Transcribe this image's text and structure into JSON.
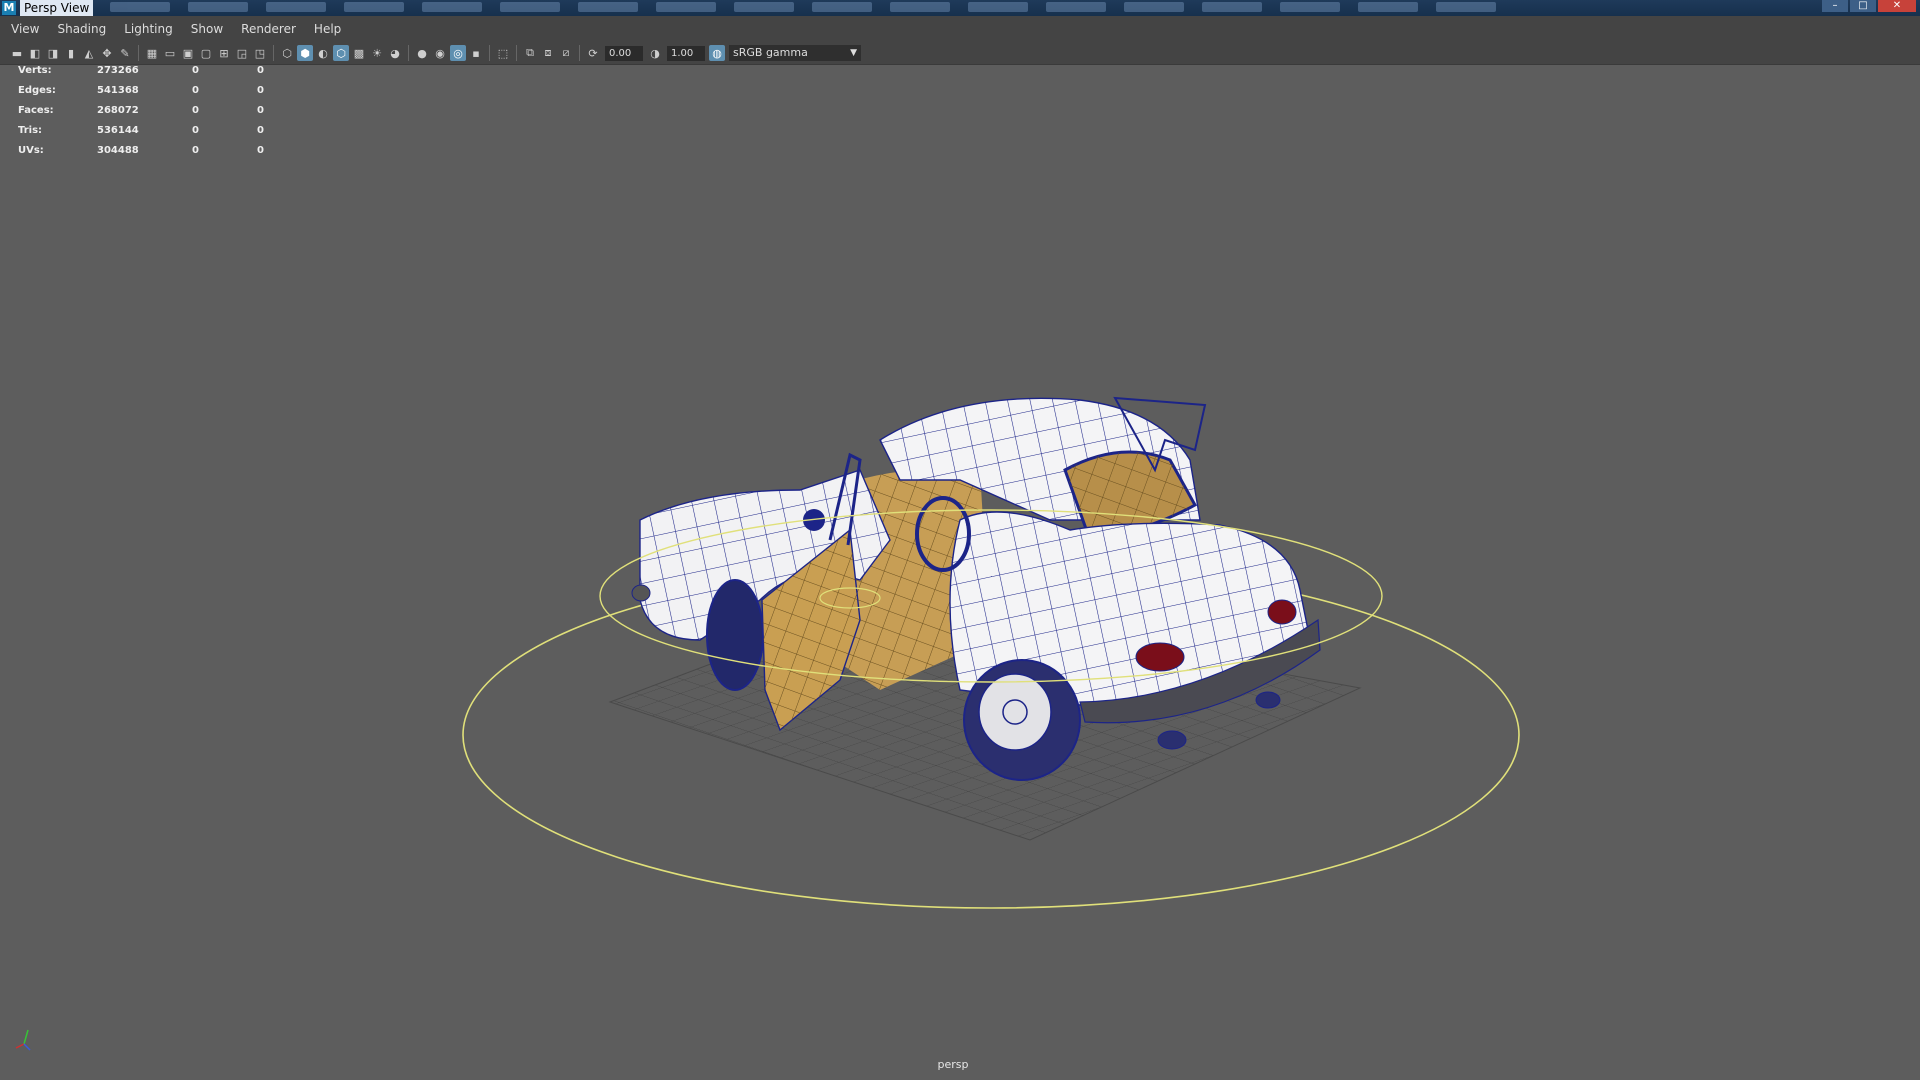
{
  "window": {
    "title": "Persp View",
    "app_icon": "M"
  },
  "menubar": {
    "items": [
      "View",
      "Shading",
      "Lighting",
      "Show",
      "Renderer",
      "Help"
    ]
  },
  "toolbar": {
    "exposure": "0.00",
    "gamma": "1.00",
    "color_space": "sRGB gamma",
    "icons": [
      "camera-icon",
      "camera-attr-icon",
      "bookmark-icon",
      "image-plane-icon",
      "grease-pencil-icon",
      "grid-icon",
      "film-gate-icon",
      "resolution-gate-icon",
      "gate-mask-icon",
      "field-chart-icon",
      "safe-action-icon",
      "safe-title-icon",
      "wireframe-icon",
      "smooth-shade-icon",
      "default-material-icon",
      "textured-icon",
      "lights-icon",
      "shadows-icon",
      "screen-space-ao-icon",
      "motion-blur-icon",
      "anti-aliasing-icon",
      "depth-of-field-icon",
      "isolate-select-icon",
      "xray-icon",
      "xray-joints-icon",
      "xray-components-icon",
      "exposure-icon",
      "gamma-icon",
      "color-management-icon"
    ]
  },
  "hud": {
    "rows": [
      {
        "label": "Verts:",
        "v1": "273266",
        "v2": "0",
        "v3": "0"
      },
      {
        "label": "Edges:",
        "v1": "541368",
        "v2": "0",
        "v3": "0"
      },
      {
        "label": "Faces:",
        "v1": "268072",
        "v2": "0",
        "v3": "0"
      },
      {
        "label": "Tris:",
        "v1": "536144",
        "v2": "0",
        "v3": "0"
      },
      {
        "label": "UVs:",
        "v1": "304488",
        "v2": "0",
        "v3": "0"
      }
    ]
  },
  "viewport": {
    "camera_label": "persp",
    "background": "#5d5d5d",
    "selection_color": "#e0e07a",
    "wire_color": "#1a2080",
    "interior_color": "#c9a055"
  }
}
